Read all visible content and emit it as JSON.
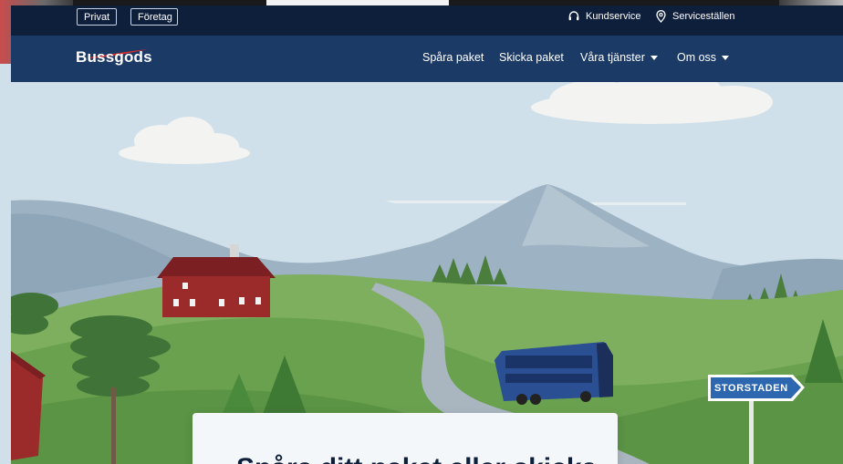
{
  "topbar": {
    "segments": [
      {
        "label": "Privat"
      },
      {
        "label": "Företag"
      }
    ],
    "links": [
      {
        "label": "Kundservice",
        "icon": "headset-icon"
      },
      {
        "label": "Serviceställen",
        "icon": "location-pin-icon"
      }
    ]
  },
  "navbar": {
    "logo": "Bussgods",
    "items": [
      {
        "label": "Spåra paket"
      },
      {
        "label": "Skicka paket"
      },
      {
        "label": "Våra tjänster",
        "icon": "caret-down-icon"
      },
      {
        "label": "Om oss",
        "icon": "caret-down-icon"
      }
    ]
  },
  "hero": {
    "sign": "STORSTADEN",
    "headline": "Spåra ditt paket eller skicka"
  },
  "colors": {
    "topbar_bg": "#0e1f3b",
    "navbar_bg": "#1c3a66",
    "accent_red": "#d62d2d",
    "sky": "#cfe0ea",
    "grass": "#5f9a4a",
    "sign_blue": "#2c67b0",
    "bus_blue": "#2a4f93"
  }
}
